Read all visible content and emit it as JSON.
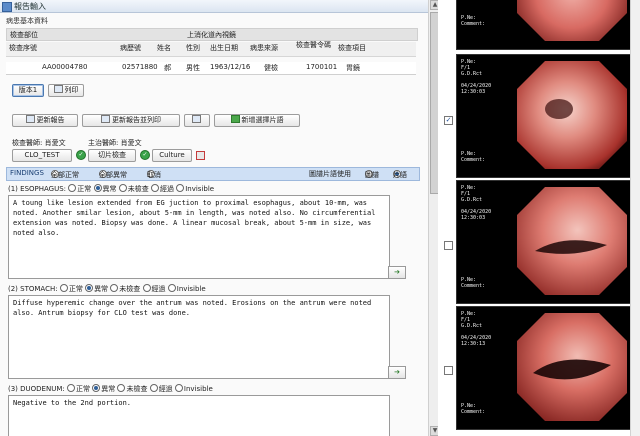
{
  "window": {
    "title": "報告輸入"
  },
  "patient": {
    "section_title": "病患基本資料",
    "dept_label": "檢查部位",
    "dept_value": "上消化道內視鏡",
    "headers": [
      "檢查序號",
      "病歷號",
      "姓名",
      "性別",
      "出生日期",
      "病患來源",
      "檢查醫令碼",
      "檢查項目"
    ],
    "values": [
      "AA00004780",
      "02571880",
      "郝",
      "男性",
      "1963/12/16",
      "健檢",
      "1700101",
      "胃鏡"
    ]
  },
  "buttons": {
    "version": "版本1",
    "print": "列印",
    "update_report": "更新報告",
    "update_report_print": "更新報告並列印",
    "new_image": "新增選擇片語"
  },
  "staff": {
    "exam_doctor_label": "檢查醫師: 肖愛文",
    "main_doctor_label": "主治醫師: 肖愛文",
    "clo_button": "CLO_TEST",
    "pathology_button": "切片檢查",
    "culture_button": "Culture"
  },
  "findings_bar": {
    "label": "FINDINGS",
    "opt_all_normal": "全部正常",
    "opt_all_abnormal": "全部異常",
    "opt_clear": "取消",
    "view_label": "圖譜片語使用",
    "opt_right1": "圖譜",
    "opt_right2": "片語"
  },
  "organs": [
    {
      "name": "(1) ESOPHAGUS:",
      "opts": [
        "正常",
        "異常",
        "未檢查",
        "經過",
        "Invisible"
      ],
      "text": "A toung like lesion extended from EG juction to proximal esophagus, about 10-mm, was noted. Another smilar lesion, about 5-mm in length, was noted also. No circumferential extension was noted. Biopsy was done. A linear mucosal break, about 5-mm in size, was noted also."
    },
    {
      "name": "(2) STOMACH:",
      "opts": [
        "正常",
        "異常",
        "未檢查",
        "經過",
        "Invisible"
      ],
      "text": "Diffuse hyperemic change over the antrum was noted. Erosions on the antrum were noted also. Antrum biopsy for CLO test was done."
    },
    {
      "name": "(3) DUODENUM:",
      "opts": [
        "正常",
        "異常",
        "未檢查",
        "經過",
        "Invisible"
      ],
      "text": "Negative to the 2nd portion."
    }
  ],
  "thumbnails": [
    {
      "top": "P.Ne:\nComment:",
      "bottom": ""
    },
    {
      "top": "P.Ne:\nF/1\nG.D.Rct\n\n04/24/2020\n12:30:03",
      "bottom": "P.Ne:\nComment:"
    },
    {
      "top": "P.Ne:\nF/1\nG.D.Rct\n\n04/24/2020\n12:30:03",
      "bottom": "P.Ne:\nComment:"
    },
    {
      "top": "P.Ne:\nF/1\nG.D.Rct\n\n04/24/2020\n12:30:13",
      "bottom": "P.Ne:\nComment:"
    }
  ],
  "colors": {
    "accent": "#2f5f98",
    "findings_bar": "#cfe0f5",
    "mucosa": "#c8524e"
  }
}
